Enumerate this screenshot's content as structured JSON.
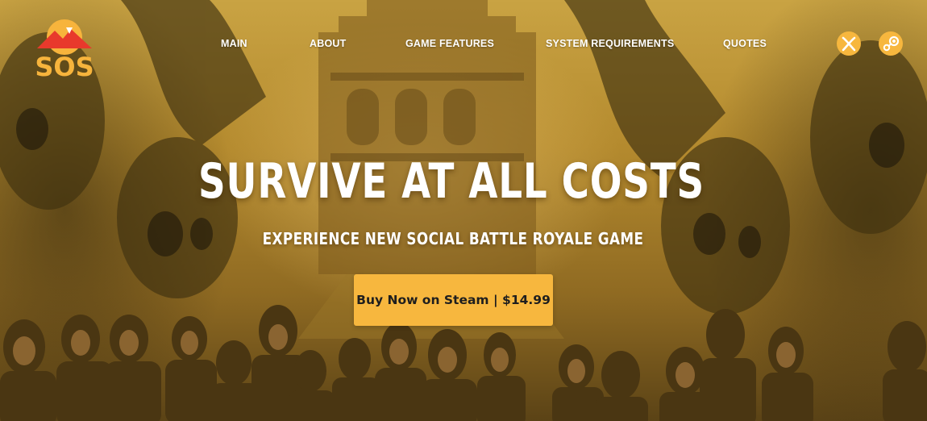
{
  "brand": {
    "logo_text": "SOS",
    "colors": {
      "logo_orange": "#f7b43c",
      "logo_red": "#e8392c",
      "accent": "#f7b73e"
    }
  },
  "nav": {
    "items": [
      {
        "label": "MAIN"
      },
      {
        "label": "ABOUT"
      },
      {
        "label": "GAME FEATURES"
      },
      {
        "label": "SYSTEM REQUIREMENTS"
      },
      {
        "label": "QUOTES"
      }
    ]
  },
  "platforms": [
    {
      "icon": "xbox-icon"
    },
    {
      "icon": "steam-icon"
    }
  ],
  "hero": {
    "headline": "SURVIVE AT ALL COSTS",
    "subheadline": "EXPERIENCE NEW SOCIAL BATTLE ROYALE GAME",
    "cta_label": "Buy Now on Steam | $14.99"
  }
}
